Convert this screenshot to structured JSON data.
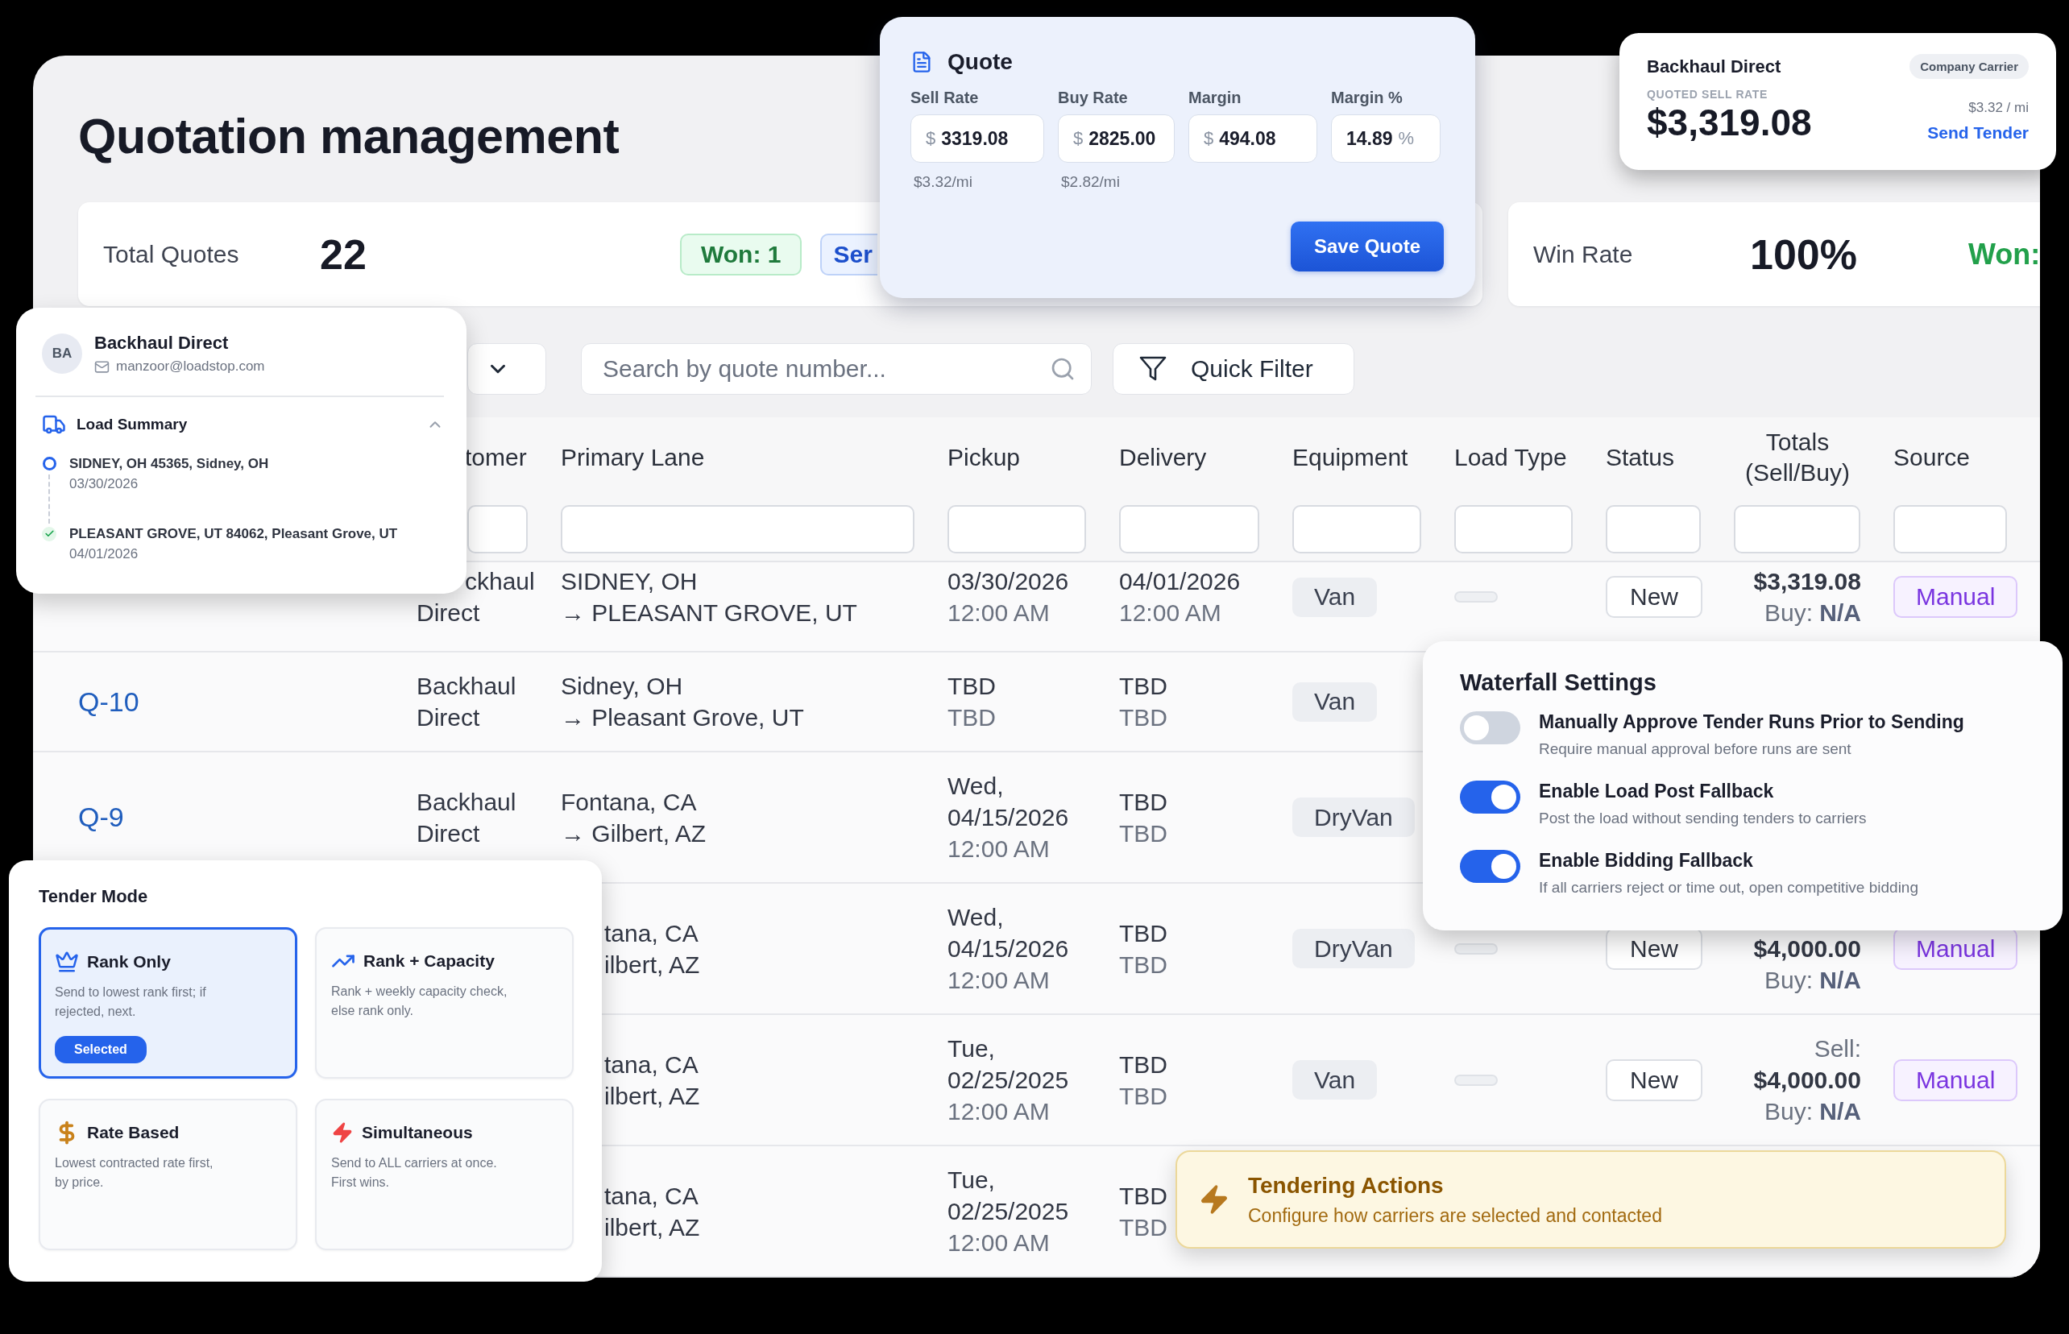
{
  "page": {
    "title": "Quotation management"
  },
  "stats": [
    {
      "label": "Total Quotes",
      "value": "22",
      "badges": [
        {
          "kind": "won",
          "text": "Won: 1"
        },
        {
          "kind": "sent",
          "text": "Ser"
        }
      ]
    },
    {
      "label": "Win Rate",
      "value": "100%",
      "badges": [
        {
          "kind": "plain",
          "text": "Won:"
        }
      ]
    }
  ],
  "filters": {
    "search": {
      "placeholder": "Search by quote number..."
    },
    "quick_filter": "Quick Filter"
  },
  "table": {
    "columns": [
      "tomer",
      "Primary Lane",
      "Pickup",
      "Delivery",
      "Equipment",
      "Load Type",
      "Status",
      "Totals (Sell/Buy)",
      "Source"
    ],
    "rows": [
      {
        "customer": "ckhaul Direct",
        "lane": [
          "SIDNEY, OH",
          "→ PLEASANT GROVE, UT"
        ],
        "pickup": [
          "03/30/2026",
          "12:00 AM"
        ],
        "delivery": [
          "04/01/2026",
          "12:00 AM"
        ],
        "equipment": "Van",
        "load_type_blank": true,
        "status": "New",
        "totals": {
          "sell": "$3,319.08",
          "buy": "Buy: **N/A**"
        },
        "source": "Manual"
      },
      {
        "quote": "Q-10",
        "customer": "Backhaul Direct",
        "lane": [
          "Sidney, OH",
          "→ Pleasant Grove, UT"
        ],
        "pickup": [
          "TBD",
          "TBD"
        ],
        "delivery": [
          "TBD",
          "TBD"
        ],
        "equipment": "Van"
      },
      {
        "quote": "Q-9",
        "customer": "Backhaul Direct",
        "lane": [
          "Fontana, CA",
          "→ Gilbert, AZ"
        ],
        "pickup": [
          "Wed,",
          "04/15/2026",
          "12:00 AM"
        ],
        "delivery": [
          "TBD",
          "TBD"
        ],
        "equipment": "DryVan"
      },
      {
        "lane": [
          "tana, CA",
          "ilbert, AZ"
        ],
        "pickup": [
          "Wed,",
          "04/15/2026",
          "12:00 AM"
        ],
        "delivery": [
          "TBD",
          "TBD"
        ],
        "equipment": "DryVan",
        "load_type_blank": true,
        "status": "New",
        "totals": {
          "sell": "$4,000.00",
          "buy": "Buy: **N/A**"
        },
        "source": "Manual"
      },
      {
        "lane": [
          "tana, CA",
          "ilbert, AZ"
        ],
        "pickup": [
          "Tue,",
          "02/25/2025",
          "12:00 AM"
        ],
        "delivery": [
          "TBD",
          "TBD"
        ],
        "equipment": "Van",
        "load_type_blank": true,
        "status": "New",
        "totals": {
          "sell_label": "Sell:",
          "sell": "$4,000.00",
          "buy": "Buy: **N/A**"
        },
        "source": "Manual"
      },
      {
        "lane": [
          "tana, CA",
          "ilbert, AZ"
        ],
        "pickup": [
          "Tue,",
          "02/25/2025",
          "12:00 AM"
        ],
        "delivery": [
          "TBD",
          "TBD"
        ]
      }
    ]
  },
  "quote_card": {
    "title": "Quote",
    "fields": [
      {
        "label": "Sell Rate",
        "prefix": "$",
        "value": "3319.08",
        "note": "$3.32/mi"
      },
      {
        "label": "Buy Rate",
        "prefix": "$",
        "value": "2825.00",
        "note": "$2.82/mi"
      },
      {
        "label": "Margin",
        "prefix": "$",
        "value": "494.08"
      },
      {
        "label": "Margin %",
        "value": "14.89",
        "suffix": "%"
      }
    ],
    "button": "Save Quote"
  },
  "carrier_card": {
    "name": "Backhaul Direct",
    "tag": "Company Carrier",
    "rate_label": "QUOTED SELL RATE",
    "rate": "$3,319.08",
    "per_mile": "$3.32 / mi",
    "action": "Send Tender"
  },
  "contact_popover": {
    "initials": "BA",
    "name": "Backhaul Direct",
    "email": "manzoor@loadstop.com",
    "section": "Load Summary",
    "expanded": true,
    "stops": [
      {
        "kind": "origin",
        "place": "SIDNEY, OH 45365, Sidney, OH",
        "date": "03/30/2026"
      },
      {
        "kind": "destination",
        "place": "PLEASANT GROVE, UT 84062, Pleasant Grove, UT",
        "date": "04/01/2026"
      }
    ]
  },
  "waterfall": {
    "title": "Waterfall Settings",
    "settings": [
      {
        "label": "Manually Approve Tender Runs Prior to Sending",
        "description": "Require manual approval before runs are sent",
        "on": false
      },
      {
        "label": "Enable Load Post Fallback",
        "description": "Post the load without sending tenders to carriers",
        "on": true
      },
      {
        "label": "Enable Bidding Fallback",
        "description": "If all carriers reject or time out, open competitive bidding",
        "on": true
      }
    ]
  },
  "tender_mode": {
    "title": "Tender Mode",
    "selected_label": "Selected",
    "options": [
      {
        "kind": "rank",
        "title": "Rank Only",
        "description": "Send to lowest rank first; if rejected, next.",
        "selected": true
      },
      {
        "kind": "capacity",
        "title": "Rank + Capacity",
        "description": "Rank + weekly capacity check, else rank only.",
        "selected": false
      },
      {
        "kind": "rate",
        "title": "Rate Based",
        "description": "Lowest contracted rate first, by price.",
        "selected": false
      },
      {
        "kind": "simultaneous",
        "title": "Simultaneous",
        "description": "Send to ALL carriers at once. First wins.",
        "selected": false
      }
    ]
  },
  "banner": {
    "title": "Tendering Actions",
    "subtitle": "Configure how carriers are selected and contacted"
  }
}
